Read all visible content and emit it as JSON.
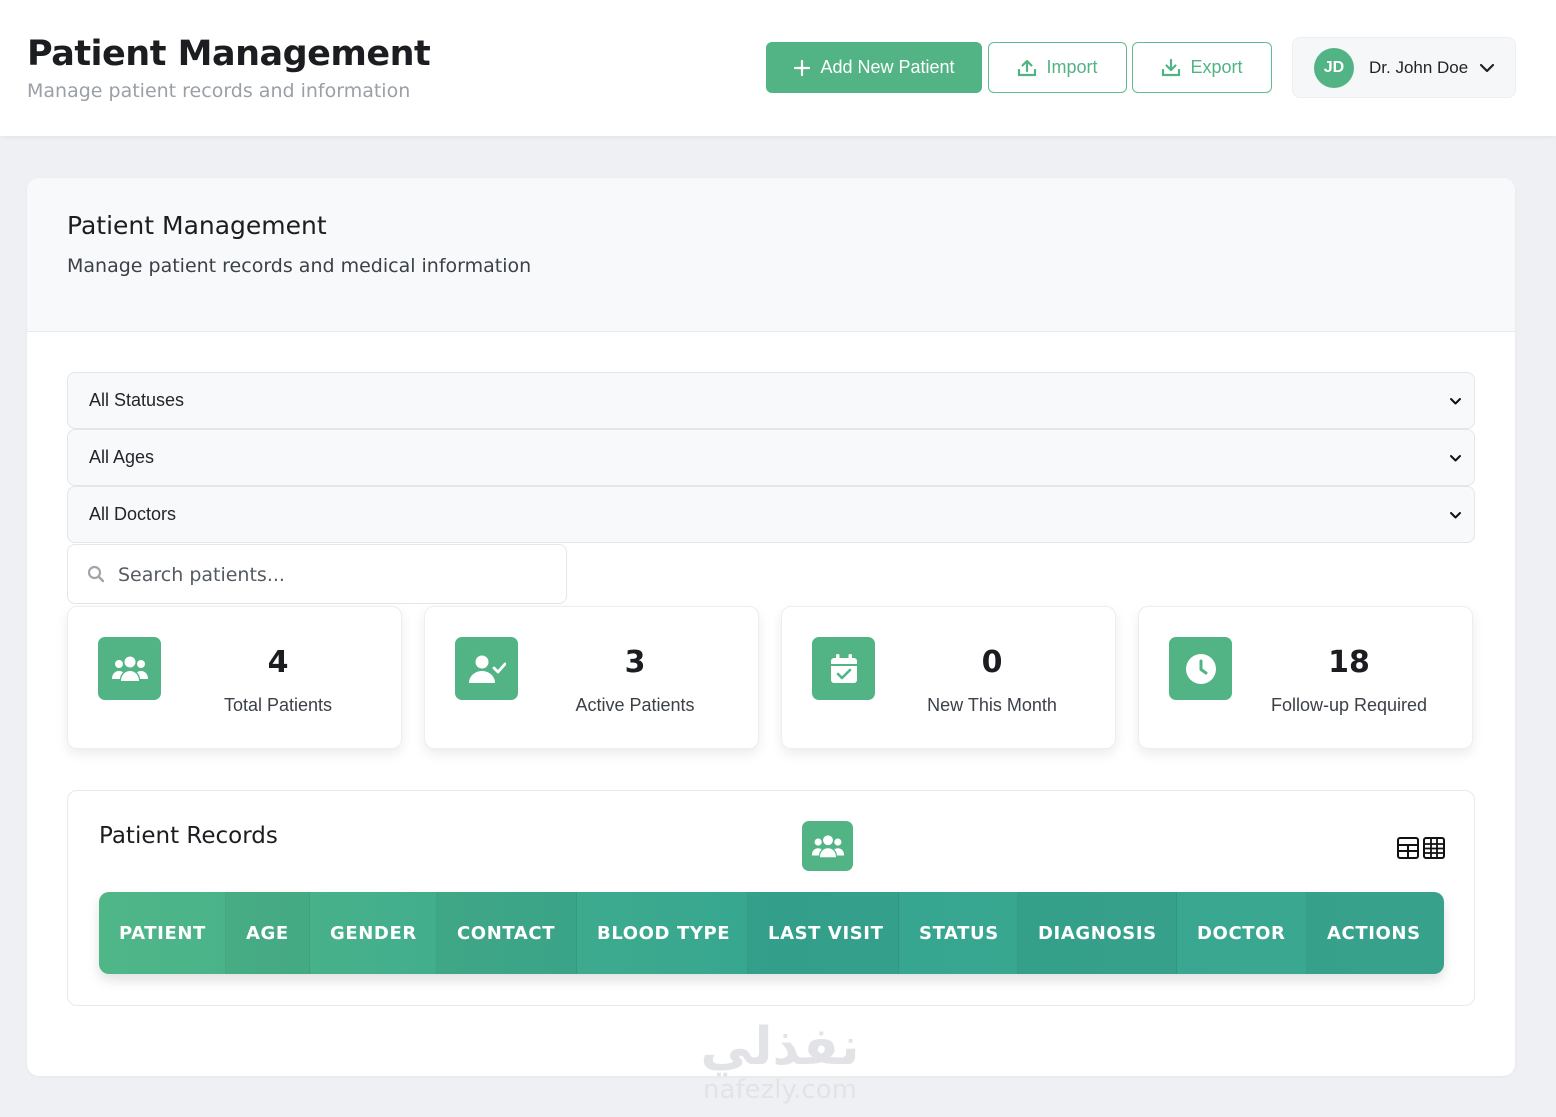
{
  "header": {
    "title": "Patient Management",
    "subtitle": "Manage patient records and information",
    "add_label": "Add New Patient",
    "import_label": "Import",
    "export_label": "Export"
  },
  "user": {
    "initials": "JD",
    "name": "Dr. John Doe"
  },
  "panel": {
    "title": "Patient Management",
    "description": "Manage patient records and medical information"
  },
  "filters": {
    "status": "All Statuses",
    "age": "All Ages",
    "doctor": "All Doctors"
  },
  "search": {
    "placeholder": "Search patients..."
  },
  "stats": [
    {
      "value": "4",
      "label": "Total Patients",
      "icon": "users-icon"
    },
    {
      "value": "3",
      "label": "Active Patients",
      "icon": "user-check-icon"
    },
    {
      "value": "0",
      "label": "New This Month",
      "icon": "calendar-check-icon"
    },
    {
      "value": "18",
      "label": "Follow-up Required",
      "icon": "clock-icon"
    }
  ],
  "records": {
    "title": "Patient Records",
    "columns": [
      "PATIENT",
      "AGE",
      "GENDER",
      "CONTACT",
      "BLOOD TYPE",
      "LAST VISIT",
      "STATUS",
      "DIAGNOSIS",
      "DOCTOR",
      "ACTIONS"
    ]
  },
  "watermark": {
    "arabic": "نفذلي",
    "latin": "nafezly.com"
  },
  "colors": {
    "accent": "#52b385",
    "accent_dark": "#36a690",
    "background": "#eef0f3"
  }
}
